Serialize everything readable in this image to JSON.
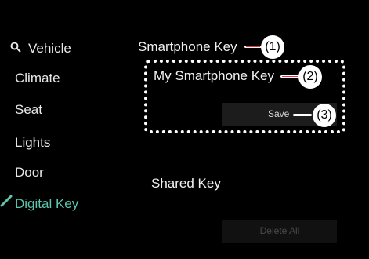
{
  "sidebar": {
    "items": [
      {
        "label": "Vehicle",
        "icon": "search-icon"
      },
      {
        "label": "Climate"
      },
      {
        "label": "Seat"
      },
      {
        "label": "Lights"
      },
      {
        "label": "Door"
      },
      {
        "label": "Digital Key",
        "active": true
      }
    ],
    "active_color": "#5ec4ad"
  },
  "main": {
    "smartphone_key_title": "Smartphone Key",
    "my_smartphone_key_label": "My Smartphone Key",
    "save_label": "Save",
    "shared_key_title": "Shared Key",
    "delete_all_label": "Delete All"
  },
  "callouts": [
    "(1)",
    "(2)",
    "(3)"
  ]
}
